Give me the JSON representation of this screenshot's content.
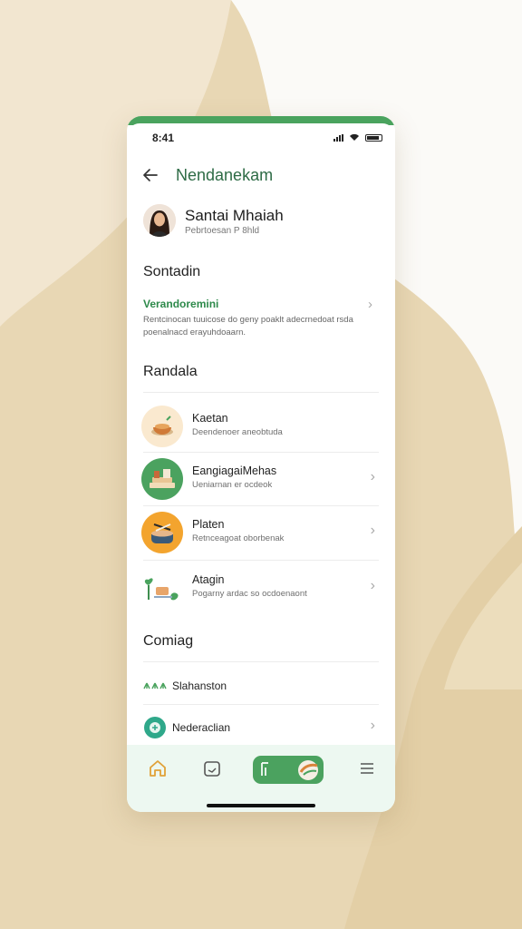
{
  "status_bar": {
    "time": "8:41"
  },
  "header": {
    "title": "Nendanekam"
  },
  "profile": {
    "name": "Santai Mhaiah",
    "subtitle": "Pebrtoesan P 8hld"
  },
  "section_1": {
    "heading": "Sontadin",
    "notice": {
      "title": "Verandoremini",
      "text": "Rentcinocan tuuicose do geny poaklt adecrnedoat rsda poenalnacd erayuhdoaarn."
    }
  },
  "section_2": {
    "heading": "Randala",
    "items": [
      {
        "title": "Kaetan",
        "subtitle": "Deendenoer aneobtuda",
        "icon": "food-bowl-icon"
      },
      {
        "title": "EangiagaiMehas",
        "subtitle": "Ueniarnan er ocdeok",
        "icon": "books-icon"
      },
      {
        "title": "Platen",
        "subtitle": "Retnceagoat oborbenak",
        "icon": "cooking-pot-icon"
      },
      {
        "title": "Atagin",
        "subtitle": "Pogarny ardac so ocdoenaont",
        "icon": "plants-icon"
      }
    ]
  },
  "section_3": {
    "heading": "Comiag",
    "rows": [
      {
        "label": "Slahanston",
        "icon": "leaves-icon"
      },
      {
        "label": "Nederaclian",
        "icon": "globe-icon"
      }
    ]
  },
  "tabbar": {
    "tabs": [
      "home-icon",
      "calendar-icon",
      "menu-book-icon",
      "menu-icon"
    ],
    "active_index": 2
  },
  "colors": {
    "accent": "#4aa35e",
    "title_green": "#2d6b45",
    "background": "#e9d8b6",
    "tabbar_bg": "#edf8f1"
  }
}
